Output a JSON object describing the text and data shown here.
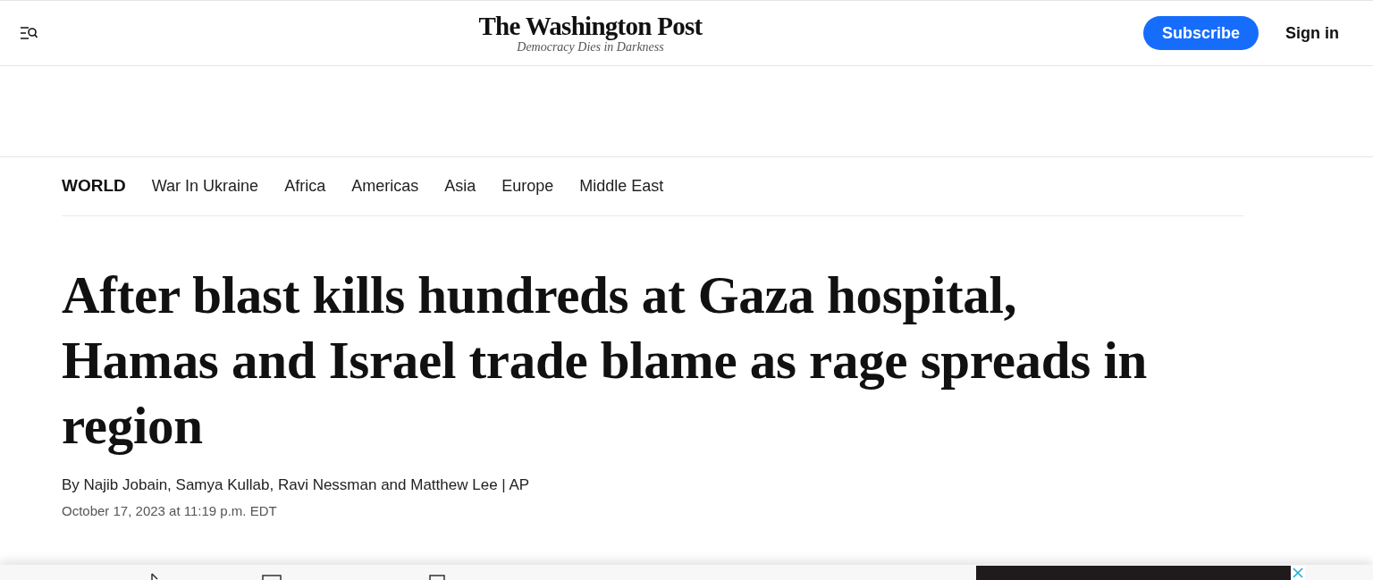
{
  "header": {
    "logo": "The Washington Post",
    "tagline": "Democracy Dies in Darkness",
    "subscribe": "Subscribe",
    "sign_in": "Sign in"
  },
  "section_nav": [
    {
      "label": "WORLD",
      "selected": true
    },
    {
      "label": "War In Ukraine",
      "selected": false
    },
    {
      "label": "Africa",
      "selected": false
    },
    {
      "label": "Americas",
      "selected": false
    },
    {
      "label": "Asia",
      "selected": false
    },
    {
      "label": "Europe",
      "selected": false
    },
    {
      "label": "Middle East",
      "selected": false
    }
  ],
  "article": {
    "headline": "After blast kills hundreds at Gaza hospital, Hamas and Israel trade blame as rage spreads in region",
    "byline": "By Najib Jobain, Samya Kullab, Ravi Nessman and Matthew Lee | AP",
    "timestamp": "October 17, 2023 at 11:19 p.m. EDT"
  }
}
